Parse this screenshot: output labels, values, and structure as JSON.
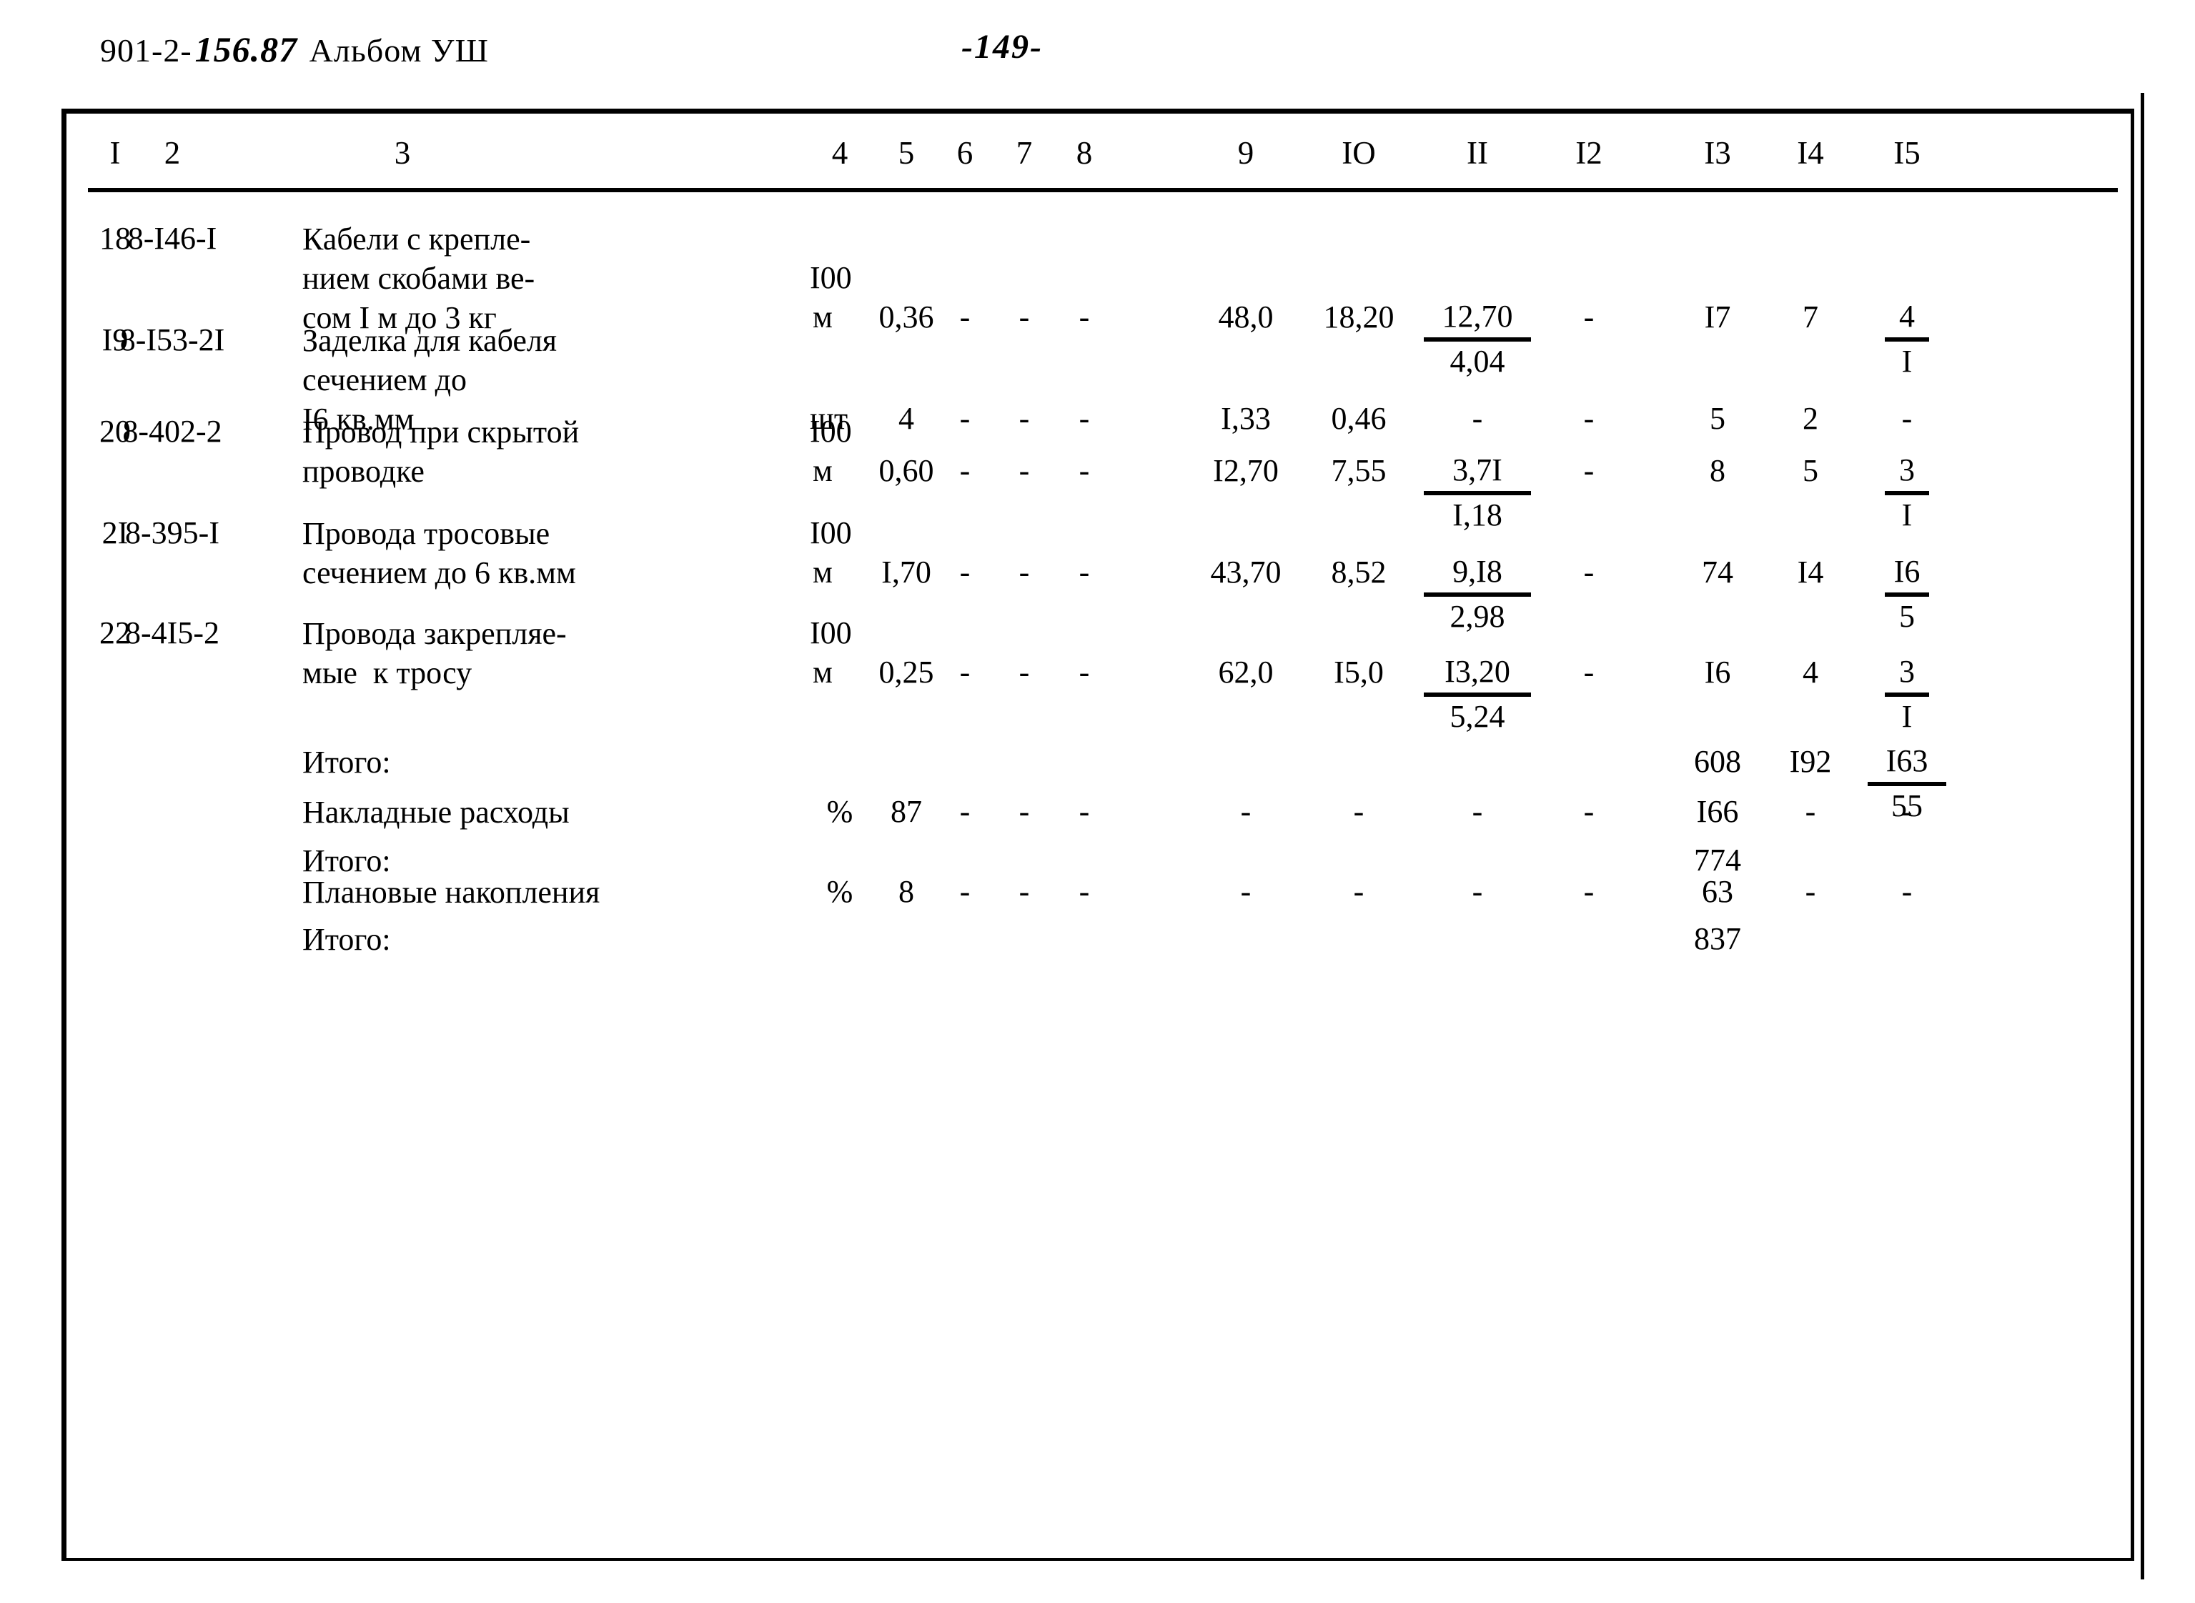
{
  "header": {
    "doc_code_prefix": "901-2-",
    "doc_code_emph": "156.87",
    "doc_code_suffix": " Альбом УШ",
    "page_number": "-149-"
  },
  "table": {
    "columns": [
      "I",
      "2",
      "3",
      "4",
      "5",
      "6",
      "7",
      "8",
      "9",
      "IO",
      "II",
      "I2",
      "I3",
      "I4",
      "I5"
    ],
    "rows": [
      {
        "no": "18",
        "code": "8-I46-I",
        "desc_lines": [
          "Кабели с крепле-",
          "нием скобами ве-",
          "сом I м до 3 кг"
        ],
        "unit_top": "I00",
        "unit_bottom": "м",
        "qty": "0,36",
        "c6": "-",
        "c7": "-",
        "c8": "-",
        "c9": "48,0",
        "c10": "18,20",
        "c11_num": "12,70",
        "c11_den": "4,04",
        "c12": "-",
        "c13": "I7",
        "c14": "7",
        "c15_num": "4",
        "c15_den": "I"
      },
      {
        "no": "I9",
        "code": "8-I53-2I",
        "desc_lines": [
          "Заделка для кабеля",
          "сечением до",
          "I6 кв.мм"
        ],
        "unit_top": "",
        "unit_bottom": "шт",
        "qty": "4",
        "c6": "-",
        "c7": "-",
        "c8": "-",
        "c9": "I,33",
        "c10": "0,46",
        "c11_num": "-",
        "c11_den": "",
        "c12": "-",
        "c13": "5",
        "c14": "2",
        "c15_num": "-",
        "c15_den": ""
      },
      {
        "no": "20",
        "code": "8-402-2",
        "desc_lines": [
          "Провод при скрытой",
          "проводке"
        ],
        "unit_top": "I00",
        "unit_bottom": "м",
        "qty": "0,60",
        "c6": "-",
        "c7": "-",
        "c8": "-",
        "c9": "I2,70",
        "c10": "7,55",
        "c11_num": "3,7I",
        "c11_den": "I,18",
        "c12": "-",
        "c13": "8",
        "c14": "5",
        "c15_num": "3",
        "c15_den": "I"
      },
      {
        "no": "2I",
        "code": "8-395-I",
        "desc_lines": [
          "Провода тросовые",
          "сечением до 6 кв.мм"
        ],
        "unit_top": "I00",
        "unit_bottom": "м",
        "qty": "I,70",
        "c6": "-",
        "c7": "-",
        "c8": "-",
        "c9": "43,70",
        "c10": "8,52",
        "c11_num": "9,I8",
        "c11_den": "2,98",
        "c12": "-",
        "c13": "74",
        "c14": "I4",
        "c15_num": "I6",
        "c15_den": "5"
      },
      {
        "no": "22",
        "code": "8-4I5-2",
        "desc_lines": [
          "Провода закрепляе-",
          "мые  к тросу"
        ],
        "unit_top": "I00",
        "unit_bottom": "м",
        "qty": "0,25",
        "c6": "-",
        "c7": "-",
        "c8": "-",
        "c9": "62,0",
        "c10": "I5,0",
        "c11_num": "I3,20",
        "c11_den": "5,24",
        "c12": "-",
        "c13": "I6",
        "c14": "4",
        "c15_num": "3",
        "c15_den": "I"
      }
    ],
    "summary": [
      {
        "label": "Итого:",
        "unit": "",
        "qty": "",
        "c6": "",
        "c7": "",
        "c8": "",
        "c9": "",
        "c10": "",
        "c11": "",
        "c12": "",
        "c13": "608",
        "c14": "I92",
        "c15_num": "I63",
        "c15_den": "55"
      },
      {
        "label": "Накладные расходы",
        "unit": "%",
        "qty": "87",
        "c6": "-",
        "c7": "-",
        "c8": "-",
        "c9": "-",
        "c10": "-",
        "c11": "-",
        "c12": "-",
        "c13": "I66",
        "c14": "-",
        "c15_num": "-",
        "c15_den": ""
      },
      {
        "label": "Итого:",
        "unit": "",
        "qty": "",
        "c6": "",
        "c7": "",
        "c8": "",
        "c9": "",
        "c10": "",
        "c11": "",
        "c12": "",
        "c13": "774",
        "c14": "",
        "c15_num": "",
        "c15_den": ""
      },
      {
        "label": "Плановые накопления",
        "unit": "%",
        "qty": "8",
        "c6": "-",
        "c7": "-",
        "c8": "-",
        "c9": "-",
        "c10": "-",
        "c11": "-",
        "c12": "-",
        "c13": "63",
        "c14": "-",
        "c15_num": "-",
        "c15_den": ""
      },
      {
        "label": "Итого:",
        "unit": "",
        "qty": "",
        "c6": "",
        "c7": "",
        "c8": "",
        "c9": "",
        "c10": "",
        "c11": "",
        "c12": "",
        "c13": "837",
        "c14": "",
        "c15_num": "",
        "c15_den": ""
      }
    ]
  }
}
